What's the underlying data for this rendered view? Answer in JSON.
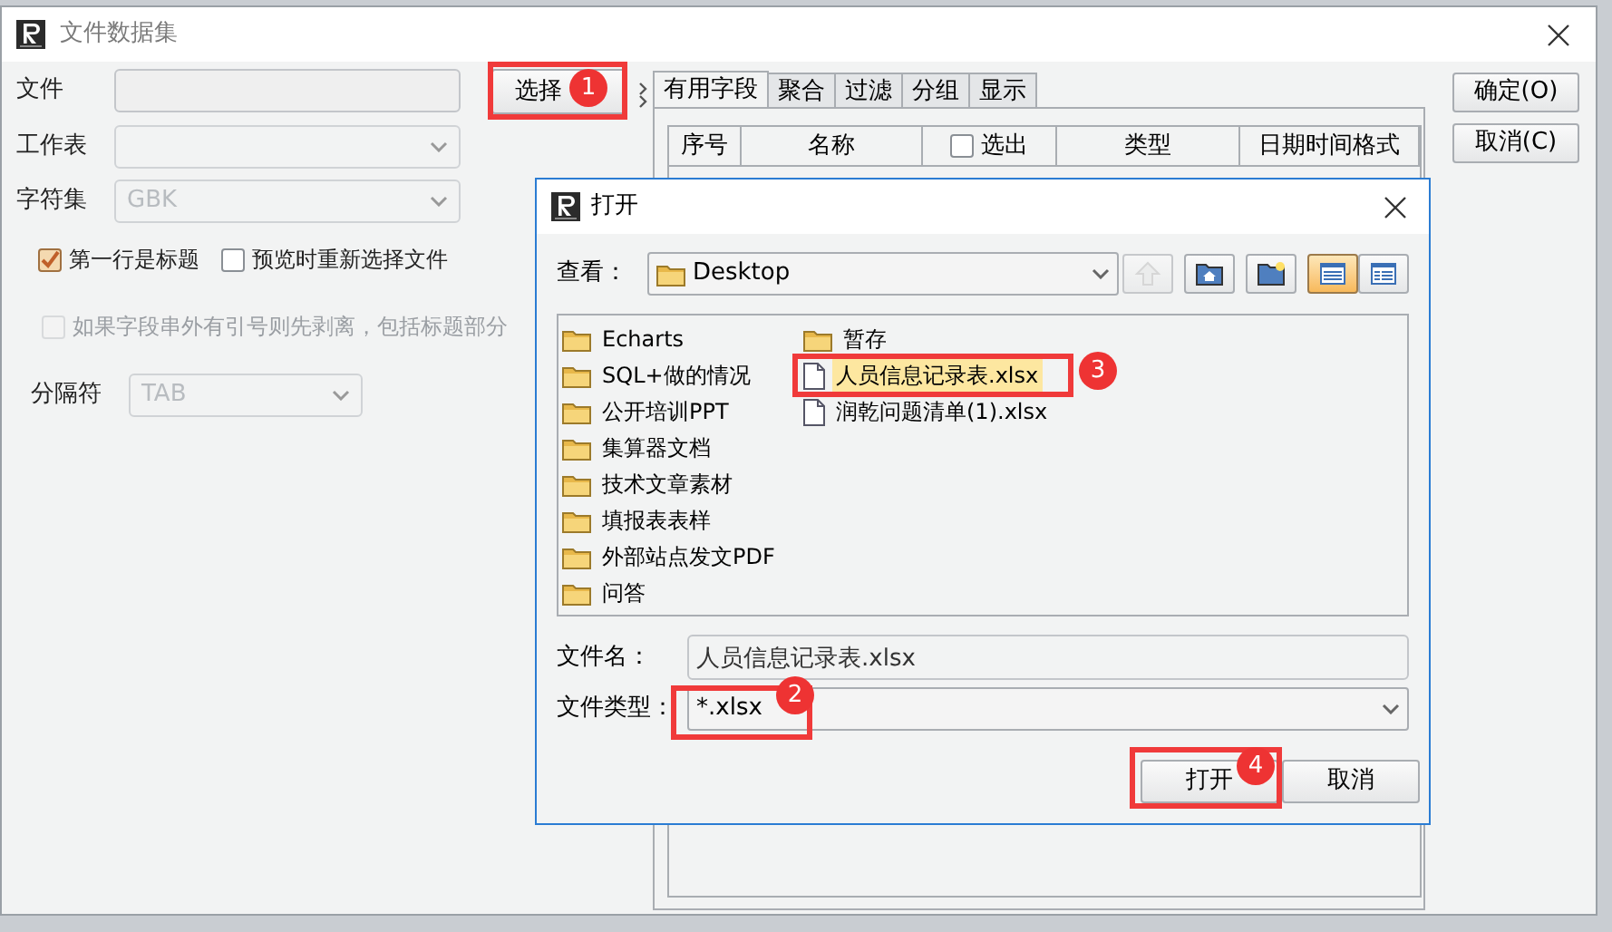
{
  "window": {
    "title": "文件数据集"
  },
  "form": {
    "file": {
      "label": "文件"
    },
    "worksheet": {
      "label": "工作表",
      "disabled": true
    },
    "charset": {
      "label": "字符集",
      "value": "GBK",
      "disabled": true
    },
    "checkboxes": [
      {
        "label": "第一行是标题",
        "checked": true,
        "disabled": false
      },
      {
        "label": "预览时重新选择文件",
        "checked": false,
        "disabled": false
      },
      {
        "label": "如果字段串外有引号则先剥离，包括标题部分",
        "checked": false,
        "disabled": true
      }
    ],
    "separator": {
      "label": "分隔符",
      "value": "TAB",
      "disabled": true
    }
  },
  "choose_button": "选择",
  "tabs": [
    {
      "label": "有用字段",
      "selected": true
    },
    {
      "label": "聚合",
      "selected": false
    },
    {
      "label": "过滤",
      "selected": false
    },
    {
      "label": "分组",
      "selected": false
    },
    {
      "label": "显示",
      "selected": false
    }
  ],
  "table": {
    "columns": [
      {
        "label": "序号",
        "kind": "text"
      },
      {
        "label": "名称",
        "kind": "text"
      },
      {
        "label": "选出",
        "kind": "checkbox",
        "checked": false
      },
      {
        "label": "类型",
        "kind": "text"
      },
      {
        "label": "日期时间格式",
        "kind": "text"
      }
    ]
  },
  "buttons": [
    "确定(O)",
    "取消(C)"
  ],
  "open_dialog": {
    "title": "打开",
    "look_in": {
      "label": "查看：",
      "value": "Desktop"
    },
    "toolbar": [
      {
        "kind": "up",
        "disabled": true,
        "selected": false
      },
      {
        "kind": "home",
        "disabled": false,
        "selected": false
      },
      {
        "kind": "new-folder",
        "disabled": false,
        "selected": false
      },
      {
        "kind": "list",
        "disabled": false,
        "selected": true
      },
      {
        "kind": "details",
        "disabled": false,
        "selected": false
      }
    ],
    "files": [
      {
        "name": "Echarts",
        "kind": "folder",
        "selected": false
      },
      {
        "name": "SQL+做的情况",
        "kind": "folder",
        "selected": false
      },
      {
        "name": "公开培训PPT",
        "kind": "folder",
        "selected": false
      },
      {
        "name": "集算器文档",
        "kind": "folder",
        "selected": false
      },
      {
        "name": "技术文章素材",
        "kind": "folder",
        "selected": false
      },
      {
        "name": "填报表表样",
        "kind": "folder",
        "selected": false
      },
      {
        "name": "外部站点发文PDF",
        "kind": "folder",
        "selected": false
      },
      {
        "name": "问答",
        "kind": "folder",
        "selected": false
      },
      {
        "name": "暂存",
        "kind": "folder",
        "selected": false
      },
      {
        "name": "人员信息记录表.xlsx",
        "kind": "file",
        "selected": true
      },
      {
        "name": "润乾问题清单(1).xlsx",
        "kind": "file",
        "selected": false
      }
    ],
    "file_name": {
      "label": "文件名：",
      "value": "人员信息记录表.xlsx"
    },
    "file_type": {
      "label": "文件类型：",
      "value": "*.xlsx"
    },
    "buttons": [
      "打开",
      "取消"
    ]
  },
  "annotations": [
    {
      "number": "1"
    },
    {
      "number": "2"
    },
    {
      "number": "3"
    },
    {
      "number": "4"
    }
  ]
}
